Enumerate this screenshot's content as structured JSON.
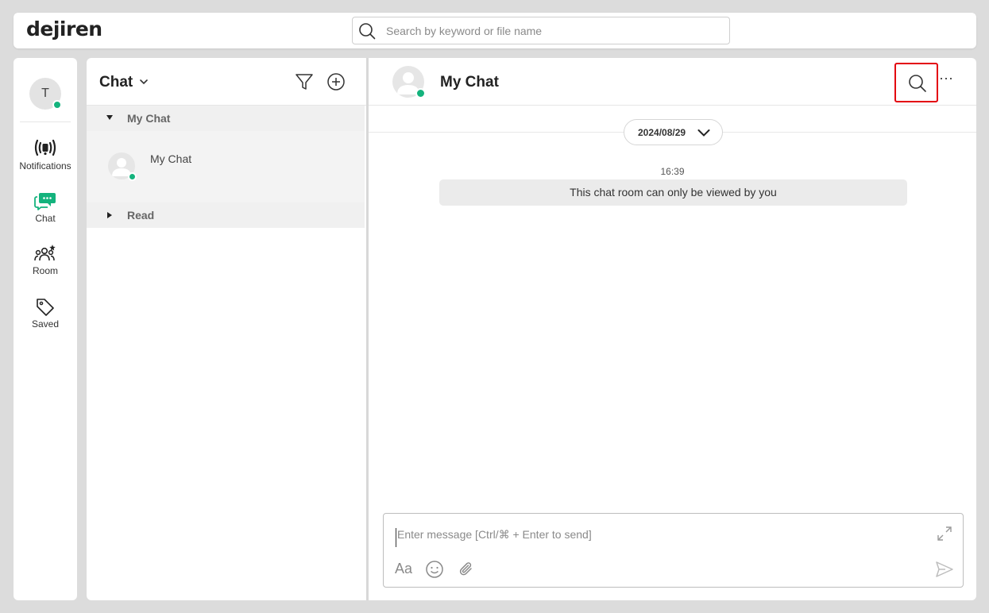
{
  "app": {
    "logo": "dejiren"
  },
  "search": {
    "placeholder": "Search by keyword or file name"
  },
  "nav": {
    "avatar_initial": "T",
    "items": [
      {
        "label": "Notifications",
        "icon": "notifications-icon"
      },
      {
        "label": "Chat",
        "icon": "chat-icon",
        "active": true
      },
      {
        "label": "Room",
        "icon": "room-icon"
      },
      {
        "label": "Saved",
        "icon": "tag-icon"
      }
    ]
  },
  "chat_list": {
    "title": "Chat",
    "groups": [
      {
        "label": "My Chat",
        "expanded": true
      },
      {
        "label": "Read",
        "expanded": false
      }
    ],
    "rooms": [
      {
        "name": "My Chat",
        "online": true
      }
    ]
  },
  "chat_pane": {
    "title": "My Chat",
    "more_label": "···",
    "date": "2024/08/29",
    "time": "16:39",
    "system_message": "This chat room can only be viewed by you",
    "composer": {
      "placeholder": "Enter message [Ctrl/⌘ + Enter to send]",
      "format_label": "Aa"
    }
  },
  "colors": {
    "accent": "#14b37d",
    "highlight_box": "#e3000f",
    "background": "#dcdcdc"
  }
}
